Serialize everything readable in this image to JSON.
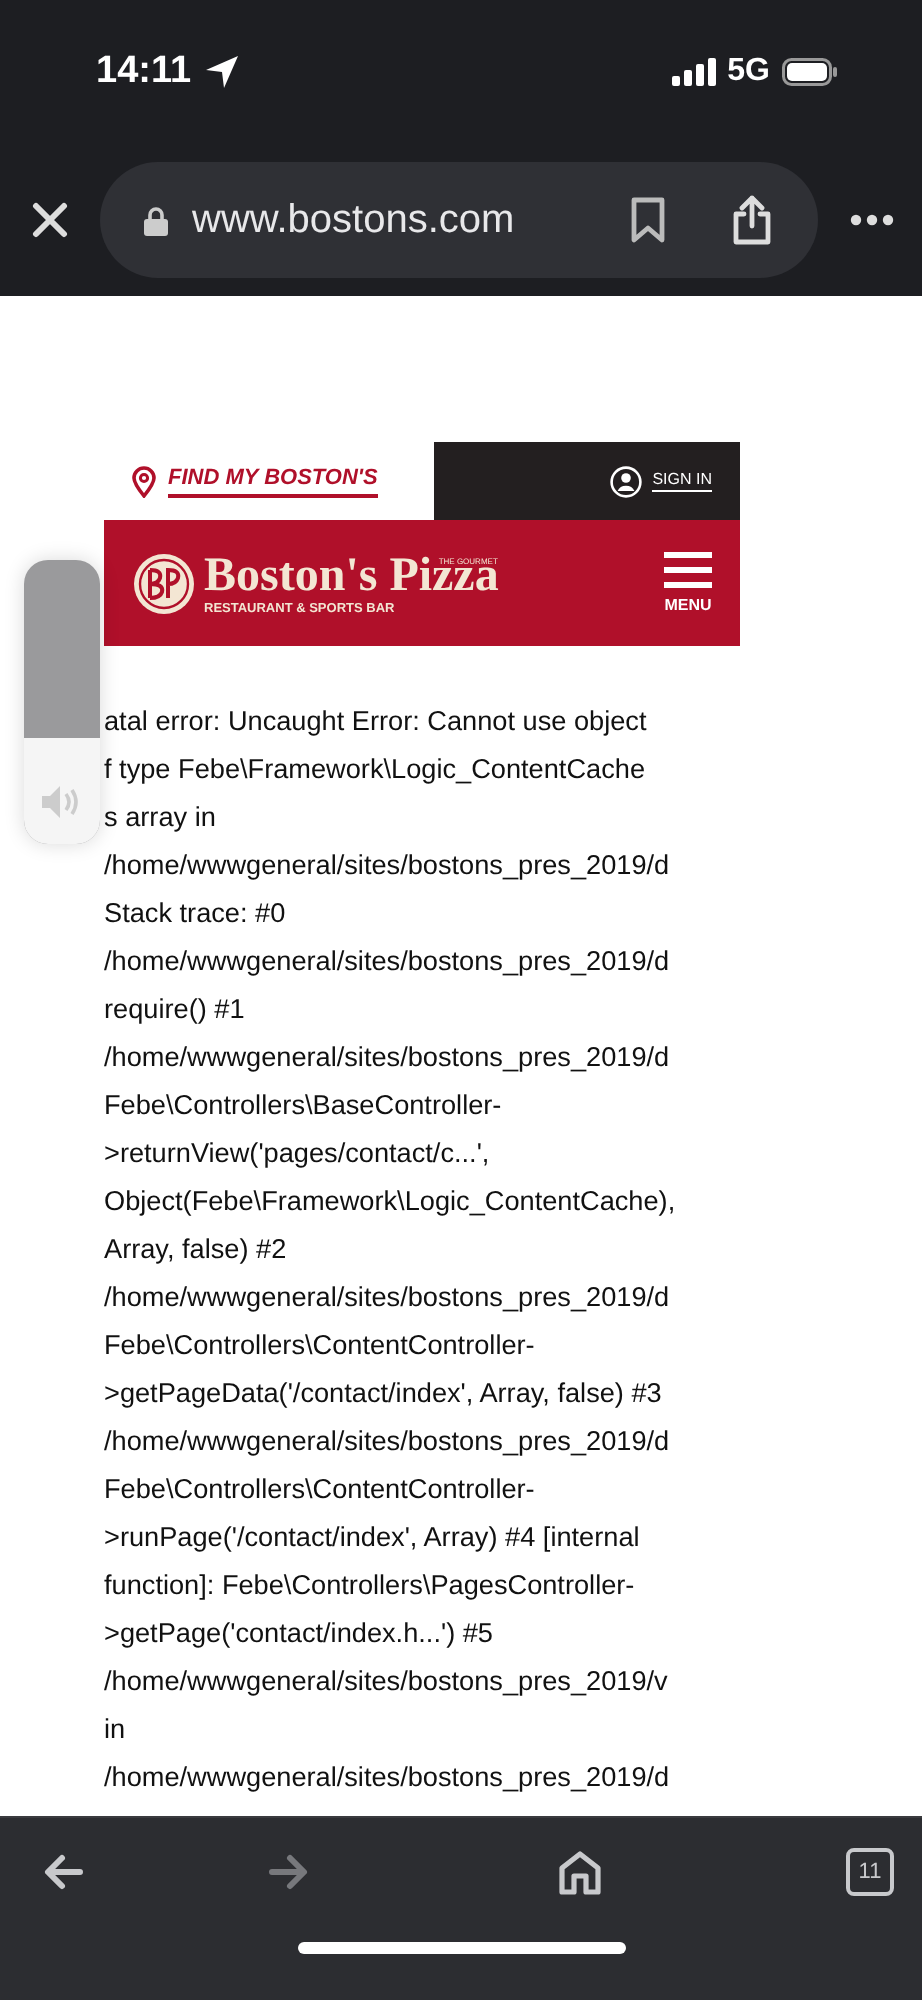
{
  "status_bar": {
    "time": "14:11",
    "network": "5G"
  },
  "address_bar": {
    "url": "www.bostons.com"
  },
  "site_header": {
    "find_link": "FIND MY BOSTON'S",
    "sign_in": "SIGN IN",
    "brand_tagline": "THE GOURMET",
    "brand_name": "Boston's Pizza",
    "brand_subtitle": "RESTAURANT & SPORTS BAR",
    "menu_label": "MENU"
  },
  "error_lines": [
    "atal error: Uncaught Error: Cannot use object",
    "f type Febe\\Framework\\Logic_ContentCache",
    "s array in",
    "/home/wwwgeneral/sites/bostons_pres_2019/d",
    "Stack trace: #0",
    "/home/wwwgeneral/sites/bostons_pres_2019/d",
    "require() #1",
    "/home/wwwgeneral/sites/bostons_pres_2019/d",
    "Febe\\Controllers\\BaseController-",
    ">returnView('pages/contact/c...',",
    "Object(Febe\\Framework\\Logic_ContentCache),",
    "Array, false) #2",
    "/home/wwwgeneral/sites/bostons_pres_2019/d",
    "Febe\\Controllers\\ContentController-",
    ">getPageData('/contact/index', Array, false) #3",
    "/home/wwwgeneral/sites/bostons_pres_2019/d",
    "Febe\\Controllers\\ContentController-",
    ">runPage('/contact/index', Array) #4 [internal",
    "function]: Febe\\Controllers\\PagesController-",
    ">getPage('contact/index.h...') #5",
    "/home/wwwgeneral/sites/bostons_pres_2019/v",
    "in",
    "/home/wwwgeneral/sites/bostons_pres_2019/d"
  ],
  "volume_hud": {
    "level": 0.37
  },
  "toolbar": [
    {
      "kind": "back",
      "disabled": false
    },
    {
      "kind": "forward",
      "disabled": true
    },
    {
      "kind": "home",
      "disabled": false
    },
    {
      "kind": "tabs",
      "disabled": false,
      "count": "11"
    }
  ]
}
